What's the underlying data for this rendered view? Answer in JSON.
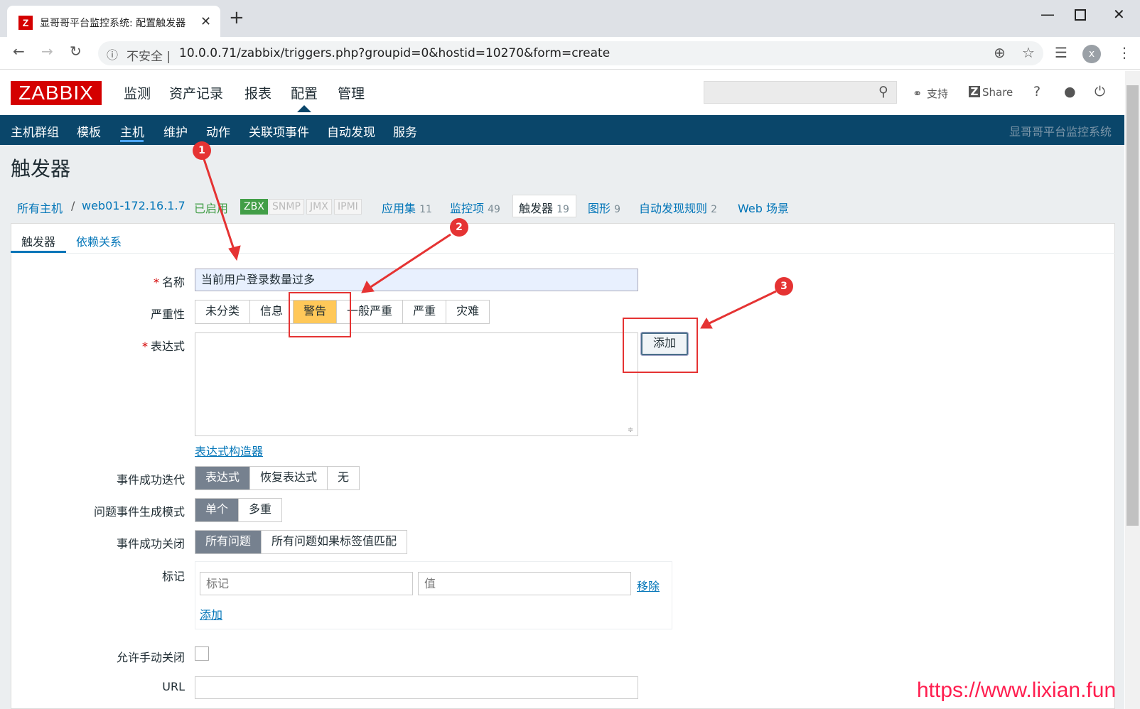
{
  "browser": {
    "tab_title": "显哥哥平台监控系统: 配置触发器",
    "tab_close": "✕",
    "new_tab": "+",
    "insecure_label": "不安全 |",
    "url": "10.0.0.71/zabbix/triggers.php?groupid=0&hostid=10270&form=create",
    "avatar_letter": "x"
  },
  "header": {
    "logo": "ZABBIX",
    "main_menu": [
      "监测",
      "资产记录",
      "报表",
      "配置",
      "管理"
    ],
    "active_menu": "配置",
    "support": "支持",
    "share": "Share",
    "help": "?"
  },
  "subnav": {
    "items": [
      "主机群组",
      "模板",
      "主机",
      "维护",
      "动作",
      "关联项事件",
      "自动发现",
      "服务"
    ],
    "active": "主机",
    "right_title": "显哥哥平台监控系统"
  },
  "page": {
    "title": "触发器",
    "breadcrumb": {
      "all_hosts": "所有主机",
      "sep": "/",
      "host": "web01-172.16.1.7",
      "status": "已启用",
      "protocols": [
        "ZBX",
        "SNMP",
        "JMX",
        "IPMI"
      ],
      "apps": "应用集",
      "apps_count": "11",
      "items": "监控项",
      "items_count": "49",
      "triggers": "触发器",
      "triggers_count": "19",
      "graphs": "图形",
      "graphs_count": "9",
      "discovery": "自动发现规则",
      "discovery_count": "2",
      "web": "Web 场景"
    }
  },
  "form": {
    "tabs": [
      "触发器",
      "依赖关系"
    ],
    "name_label": "名称",
    "name_value": "当前用户登录数量过多",
    "severity_label": "严重性",
    "severity_options": [
      "未分类",
      "信息",
      "警告",
      "一般严重",
      "严重",
      "灾难"
    ],
    "severity_selected": "警告",
    "expression_label": "表达式",
    "add_button": "添加",
    "expression_builder": "表达式构造器",
    "ok_event_label": "事件成功迭代",
    "ok_event_options": [
      "表达式",
      "恢复表达式",
      "无"
    ],
    "problem_mode_label": "问题事件生成模式",
    "problem_mode_options": [
      "单个",
      "多重"
    ],
    "ok_close_label": "事件成功关闭",
    "ok_close_options": [
      "所有问题",
      "所有问题如果标签值匹配"
    ],
    "tags_label": "标记",
    "tag_placeholder": "标记",
    "value_placeholder": "值",
    "remove_link": "移除",
    "add_link": "添加",
    "manual_close_label": "允许手动关闭",
    "url_label": "URL"
  },
  "annotations": {
    "markers": [
      "1",
      "2",
      "3"
    ],
    "color": "#e53333"
  },
  "watermark": "https://www.lixian.fun"
}
